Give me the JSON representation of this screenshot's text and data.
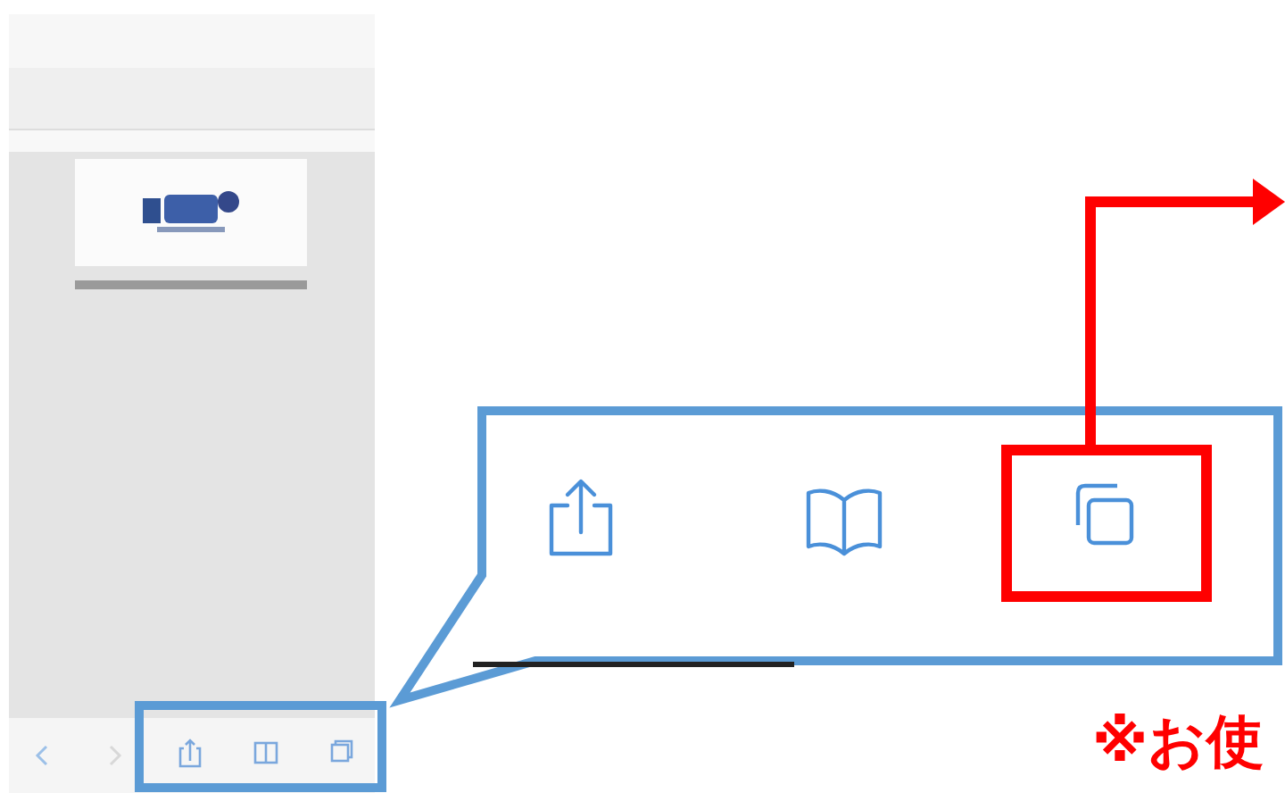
{
  "annotation": {
    "note": "※お使"
  }
}
